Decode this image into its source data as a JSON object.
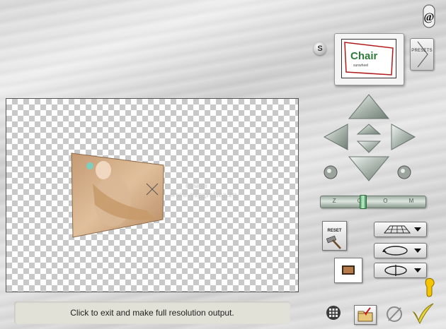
{
  "status": {
    "message": "Click to exit and make full resolution output."
  },
  "buttons": {
    "s_label": "S",
    "presets_label": "PRESETS",
    "reset_label": "RESET"
  },
  "zoom": {
    "label": "Z O O M",
    "level": 0.4
  },
  "thumbnail": {
    "text_main": "Chair",
    "text_sub": "sunwheel"
  },
  "watermark": {
    "name": "Rinazia",
    "site": "www.pspgrafica.eu"
  },
  "icons": {
    "top_right": "ampersand-icon",
    "grid": "grid-icon",
    "save": "folder-save-icon",
    "no": "no-entry-icon",
    "ok": "checkmark-icon",
    "help": "help-hand-icon"
  },
  "colors": {
    "arrow": "#a9b5ad",
    "zoom_knob": "#5fae74",
    "checkmark": "#e3d23a",
    "help": "#f4c400"
  }
}
